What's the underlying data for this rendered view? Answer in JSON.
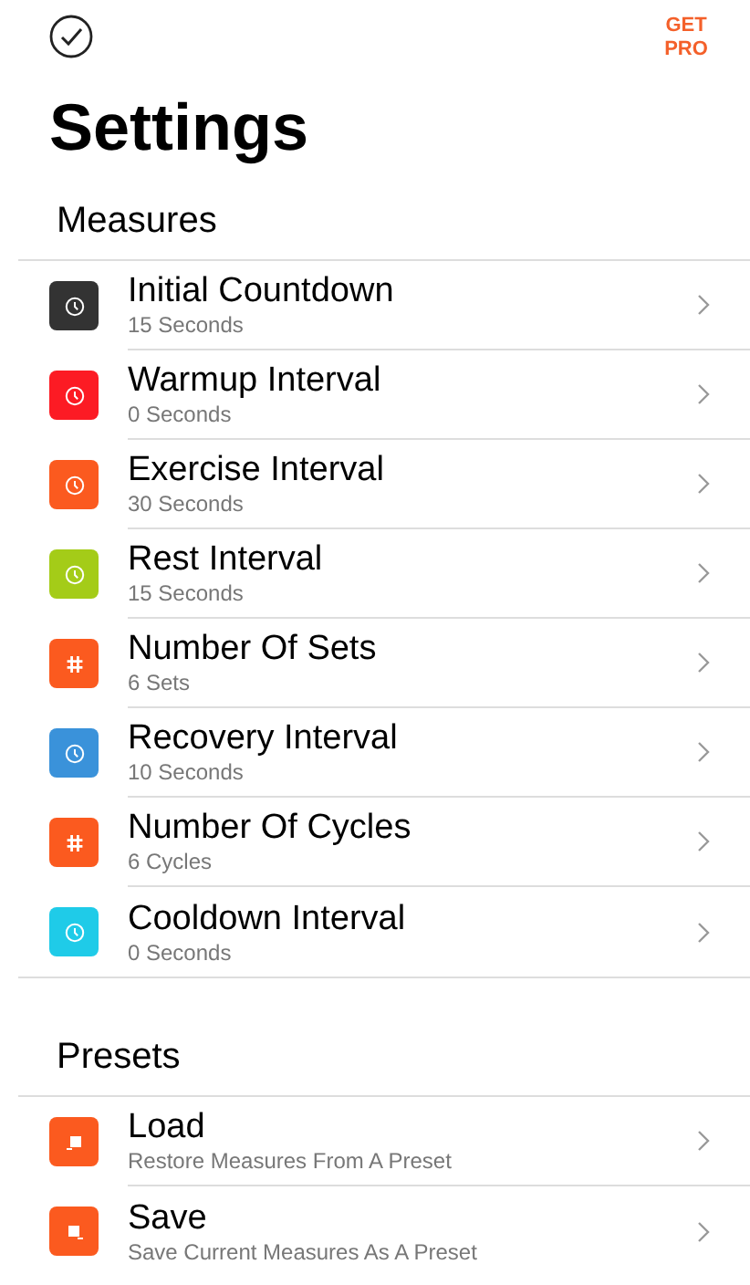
{
  "header": {
    "action": "GET PRO"
  },
  "title": "Settings",
  "sections": [
    {
      "heading": "Measures",
      "items": [
        {
          "kind": "timer",
          "color": "#333333",
          "title": "Initial Countdown",
          "subtitle": "15 Seconds"
        },
        {
          "kind": "timer",
          "color": "#fc1b24",
          "title": "Warmup Interval",
          "subtitle": "0 Seconds"
        },
        {
          "kind": "timer",
          "color": "#fb5a1f",
          "title": "Exercise Interval",
          "subtitle": "30 Seconds"
        },
        {
          "kind": "timer",
          "color": "#a4cc18",
          "title": "Rest Interval",
          "subtitle": "15 Seconds"
        },
        {
          "kind": "count",
          "color": "#fb5a1f",
          "title": "Number Of Sets",
          "subtitle": "6 Sets"
        },
        {
          "kind": "timer",
          "color": "#3a92da",
          "title": "Recovery Interval",
          "subtitle": "10 Seconds"
        },
        {
          "kind": "count",
          "color": "#fb5a1f",
          "title": "Number Of Cycles",
          "subtitle": "6 Cycles"
        },
        {
          "kind": "timer",
          "color": "#1fcbe8",
          "title": "Cooldown Interval",
          "subtitle": "0 Seconds"
        }
      ]
    },
    {
      "heading": "Presets",
      "items": [
        {
          "kind": "load",
          "color": "#fb5a1f",
          "title": "Load",
          "subtitle": "Restore Measures From A Preset"
        },
        {
          "kind": "save",
          "color": "#fb5a1f",
          "title": "Save",
          "subtitle": "Save Current Measures As A Preset"
        }
      ]
    }
  ]
}
